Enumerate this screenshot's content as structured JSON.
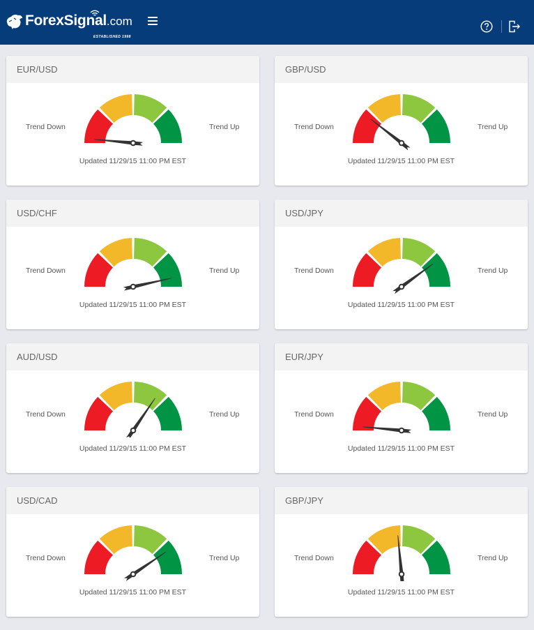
{
  "header": {
    "logo_text": "ForexSignal",
    "logo_suffix": ".com",
    "logo_tagline": "ESTABLISHED 1998",
    "menu_icon": "hamburger-menu-icon",
    "help_icon": "help-circle-icon",
    "logout_icon": "logout-icon",
    "background_color": "#073c7a"
  },
  "gauge_colors": {
    "red": "#ed1c24",
    "yellow": "#f3b72a",
    "light_green": "#8dc63f",
    "dark_green": "#009444",
    "needle": "#333333"
  },
  "labels": {
    "trend_down": "Trend Down",
    "trend_up": "Trend Up"
  },
  "cards": [
    {
      "pair": "EUR/USD",
      "trend_value": 3,
      "updated": "Updated 11/29/15 11:00 PM EST"
    },
    {
      "pair": "GBP/USD",
      "trend_value": 21,
      "updated": "Updated 11/29/15 11:00 PM EST"
    },
    {
      "pair": "USD/CHF",
      "trend_value": 93,
      "updated": "Updated 11/29/15 11:00 PM EST"
    },
    {
      "pair": "USD/JPY",
      "trend_value": 80,
      "updated": "Updated 11/29/15 11:00 PM EST"
    },
    {
      "pair": "AUD/USD",
      "trend_value": 69,
      "updated": "Updated 11/29/15 11:00 PM EST"
    },
    {
      "pair": "EUR/JPY",
      "trend_value": 3,
      "updated": "Updated 11/29/15 11:00 PM EST"
    },
    {
      "pair": "USD/CAD",
      "trend_value": 81,
      "updated": "Updated 11/29/15 11:00 PM EST"
    },
    {
      "pair": "GBP/JPY",
      "trend_value": 47,
      "updated": "Updated 11/29/15 11:00 PM EST"
    }
  ]
}
